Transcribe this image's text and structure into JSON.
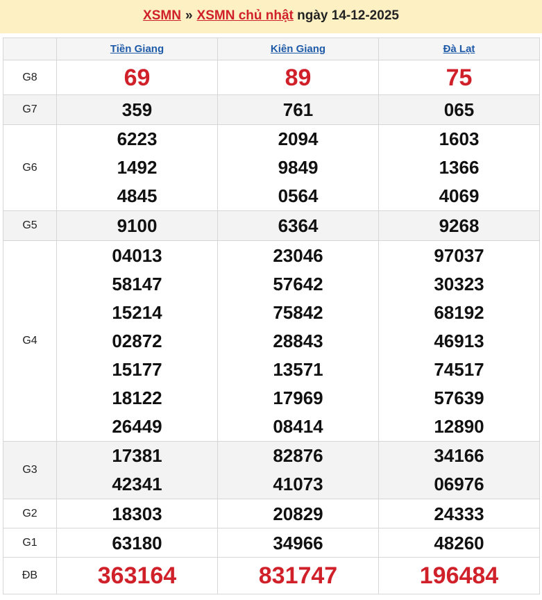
{
  "header": {
    "link1": "XSMN",
    "separator": "»",
    "link2": "XSMN chủ nhật",
    "date_text": "ngày 14-12-2025"
  },
  "provinces": [
    "Tiền Giang",
    "Kiên Giang",
    "Đà Lạt"
  ],
  "prizes": [
    {
      "label": "G8",
      "values": [
        [
          "69"
        ],
        [
          "89"
        ],
        [
          "75"
        ]
      ]
    },
    {
      "label": "G7",
      "values": [
        [
          "359"
        ],
        [
          "761"
        ],
        [
          "065"
        ]
      ]
    },
    {
      "label": "G6",
      "values": [
        [
          "6223",
          "1492",
          "4845"
        ],
        [
          "2094",
          "9849",
          "0564"
        ],
        [
          "1603",
          "1366",
          "4069"
        ]
      ]
    },
    {
      "label": "G5",
      "values": [
        [
          "9100"
        ],
        [
          "6364"
        ],
        [
          "9268"
        ]
      ]
    },
    {
      "label": "G4",
      "values": [
        [
          "04013",
          "58147",
          "15214",
          "02872",
          "15177",
          "18122",
          "26449"
        ],
        [
          "23046",
          "57642",
          "75842",
          "28843",
          "13571",
          "17969",
          "08414"
        ],
        [
          "97037",
          "30323",
          "68192",
          "46913",
          "74517",
          "57639",
          "12890"
        ]
      ]
    },
    {
      "label": "G3",
      "values": [
        [
          "17381",
          "42341"
        ],
        [
          "82876",
          "41073"
        ],
        [
          "34166",
          "06976"
        ]
      ]
    },
    {
      "label": "G2",
      "values": [
        [
          "18303"
        ],
        [
          "20829"
        ],
        [
          "24333"
        ]
      ]
    },
    {
      "label": "G1",
      "values": [
        [
          "63180"
        ],
        [
          "34966"
        ],
        [
          "48260"
        ]
      ]
    },
    {
      "label": "ĐB",
      "values": [
        [
          "363164"
        ],
        [
          "831747"
        ],
        [
          "196484"
        ]
      ]
    }
  ],
  "colors": {
    "accent_red": "#d0212b",
    "link_blue": "#1e5aa8",
    "header_bg": "#fdf1c4"
  }
}
